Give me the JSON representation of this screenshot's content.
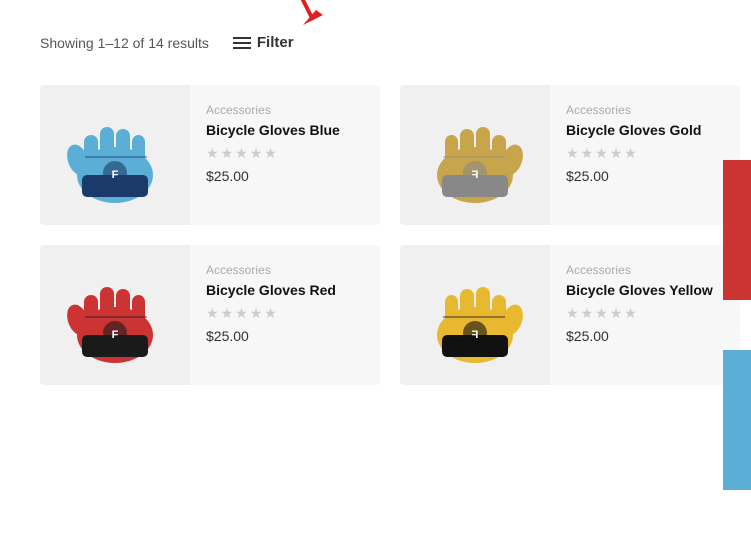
{
  "toolbar": {
    "results_text": "Showing 1–12 of 14 results",
    "filter_label": "Filter"
  },
  "products": [
    {
      "id": "blue",
      "category": "Accessories",
      "name": "Bicycle Gloves Blue",
      "price": "$25.00",
      "stars": [
        0,
        0,
        0,
        0,
        0
      ],
      "color_class": "glove-blue",
      "color_hex": "#5bafd6",
      "accent": "#1a3a6b"
    },
    {
      "id": "gold",
      "category": "Accessories",
      "name": "Bicycle Gloves Gold",
      "price": "$25.00",
      "stars": [
        0,
        0,
        0,
        0,
        0
      ],
      "color_class": "glove-gold",
      "color_hex": "#c8a54a",
      "accent": "#888"
    },
    {
      "id": "red",
      "category": "Accessories",
      "name": "Bicycle Gloves Red",
      "price": "$25.00",
      "stars": [
        0,
        0,
        0,
        0,
        0
      ],
      "color_class": "glove-red",
      "color_hex": "#cc3333",
      "accent": "#1a1a1a"
    },
    {
      "id": "yellow",
      "category": "Accessories",
      "name": "Bicycle Gloves Yellow",
      "price": "$25.00",
      "stars": [
        0,
        0,
        0,
        0,
        0
      ],
      "color_class": "glove-yellow",
      "color_hex": "#e8b830",
      "accent": "#111"
    }
  ]
}
